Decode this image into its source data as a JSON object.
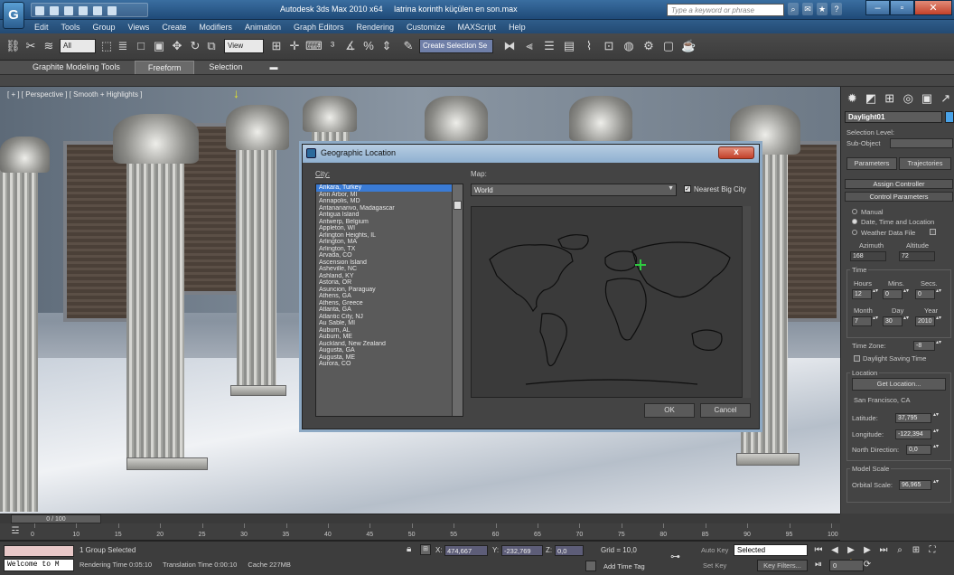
{
  "titlebar": {
    "app_title": "Autodesk 3ds Max 2010 x64",
    "file_name": "latrina korinth küçülen en son.max",
    "search_placeholder": "Type a keyword or phrase",
    "logo": "G"
  },
  "menu": [
    "Edit",
    "Tools",
    "Group",
    "Views",
    "Create",
    "Modifiers",
    "Animation",
    "Graph Editors",
    "Rendering",
    "Customize",
    "MAXScript",
    "Help"
  ],
  "toolbar": {
    "filter_value": "All",
    "refcoord_value": "View",
    "named_selection_placeholder": "Create Selection Se"
  },
  "ribbon": {
    "tabs": [
      "Graphite Modeling Tools",
      "Freeform",
      "Selection"
    ],
    "active_tab": "Freeform"
  },
  "viewport": {
    "label": "[ + ] [ Perspective ] [ Smooth + Highlights ]"
  },
  "dialog": {
    "title": "Geographic Location",
    "close_symbol": "x",
    "city_label": "City:",
    "map_label": "Map:",
    "map_value": "World",
    "nearest_big_city_label": "Nearest Big City",
    "nearest_big_city_checked": true,
    "ok_label": "OK",
    "cancel_label": "Cancel",
    "selected_city": "Ankara, Turkey",
    "cities": [
      "Ankara, Turkey",
      "Ann Arbor, MI",
      "Annapolis, MD",
      "Antananarivo, Madagascar",
      "Antigua Island",
      "Antwerp, Belgium",
      "Appleton, WI",
      "Arlington Heights, IL",
      "Arlington, MA",
      "Arlington, TX",
      "Arvada, CO",
      "Ascension Island",
      "Asheville, NC",
      "Ashland, KY",
      "Astoria, OR",
      "Asuncion, Paraguay",
      "Athens, GA",
      "Athens, Greece",
      "Atlanta, GA",
      "Atlantic City, NJ",
      "Au Sable, MI",
      "Auburn, AL",
      "Auburn, ME",
      "Auckland, New Zealand",
      "Augusta, GA",
      "Augusta, ME",
      "Aurora, CO"
    ]
  },
  "command_panel": {
    "object_name": "Daylight01",
    "object_color": "#4aa3e8",
    "selection_level_label": "Selection Level:",
    "sub_object_label": "Sub-Object",
    "tabs": [
      "Parameters",
      "Trajectories"
    ],
    "rollouts": {
      "assign_controller": "Assign Controller",
      "control_parameters": "Control Parameters"
    },
    "radios": [
      {
        "label": "Manual",
        "on": false
      },
      {
        "label": "Date, Time and Location",
        "on": true
      },
      {
        "label": "Weather Data File",
        "on": false
      }
    ],
    "azimuth_label": "Azimuth",
    "altitude_label": "Altitude",
    "azimuth_value": "168",
    "altitude_value": "72",
    "time_group": "Time",
    "hours_label": "Hours",
    "mins_label": "Mins.",
    "secs_label": "Secs.",
    "hours": "12",
    "mins": "0",
    "secs": "0",
    "month_label": "Month",
    "day_label": "Day",
    "year_label": "Year",
    "month": "7",
    "day": "30",
    "year": "2010",
    "time_zone_label": "Time Zone:",
    "time_zone": "-8",
    "daylight_saving_label": "Daylight Saving Time",
    "location_group": "Location",
    "get_location_label": "Get Location...",
    "location_name": "San Francisco, CA",
    "latitude_label": "Latitude:",
    "latitude": "37,795",
    "longitude_label": "Longitude:",
    "longitude": "-122,394",
    "north_direction_label": "North Direction:",
    "north_direction": "0,0",
    "model_scale_group": "Model Scale",
    "orbital_scale_label": "Orbital Scale:",
    "orbital_scale": "96,965"
  },
  "timeline": {
    "slider_label": "0 / 100",
    "ticks": [
      "0",
      "10",
      "15",
      "20",
      "25",
      "30",
      "35",
      "40",
      "45",
      "50",
      "55",
      "60",
      "65",
      "70",
      "75",
      "80",
      "85",
      "90",
      "95",
      "100"
    ]
  },
  "status": {
    "welcome": "Welcome to M",
    "selection": "1 Group Selected",
    "rendering_time": "Rendering Time 0:05:10",
    "translation_time": "Translation Time 0:00:10",
    "cache": "Cache 227MB",
    "x_label": "X:",
    "x_value": "474,667",
    "y_label": "Y:",
    "y_value": "-232,769",
    "z_label": "Z:",
    "z_value": "0,0",
    "grid": "Grid = 10,0",
    "add_time_tag": "Add Time Tag",
    "auto_key": "Auto Key",
    "set_key": "Set Key",
    "selected_option": "Selected",
    "key_filters": "Key Filters...",
    "frame": "0"
  }
}
